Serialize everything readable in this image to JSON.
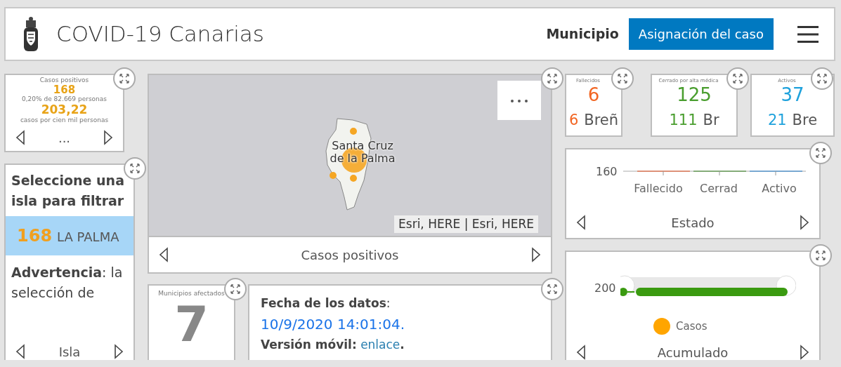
{
  "header": {
    "title": "COVID-19 Canarias",
    "tabs": [
      {
        "label": "Municipio",
        "selected": false
      },
      {
        "label": "Asignación del caso",
        "selected": true
      }
    ]
  },
  "positives_card": {
    "title": "Casos positivos",
    "value": "168",
    "value_note": "0,20% de 82.669 personas",
    "rate": "203,22",
    "rate_note": "casos por cien mil personas",
    "footer": "..."
  },
  "island_list": {
    "title": "Seleccione una isla para filtrar",
    "items": [
      {
        "count": "168",
        "name": "LA PALMA",
        "selected": true
      }
    ],
    "warning": "**Advertencia**: la selección de",
    "footer": "Isla"
  },
  "map": {
    "place_label": "Santa Cruz de la Palma",
    "attribution": "Esri, HERE | Esri, HERE",
    "footer": "Casos positivos"
  },
  "municipios_card": {
    "title": "Municipios afectados",
    "value": "7"
  },
  "info": {
    "date_label": "**Fecha de los datos**:",
    "date_value": "10/9/2020 14:01:04.",
    "mobile_label": "Versión móvil:",
    "mobile_link": "enlace",
    "mobile_suffix": "."
  },
  "kpis": [
    {
      "title": "Fallecidos",
      "value": "6",
      "sub_value": "6",
      "sub_label": "Breñ",
      "color": "#f26522"
    },
    {
      "title": "Cerrado por alta médica",
      "value": "125",
      "sub_value": "111",
      "sub_label": "Br",
      "color": "#4a9e2f"
    },
    {
      "title": "Activos",
      "value": "37",
      "sub_value": "21",
      "sub_label": "Bre",
      "color": "#1fa2dc"
    }
  ],
  "status_chart": {
    "tick": "160",
    "categories": [
      "Fallecido",
      "Cerrad",
      "Activo"
    ],
    "footer": "Estado"
  },
  "cumulative_chart": {
    "tick": "200",
    "legend": [
      {
        "label": "Casos",
        "color": "#ffa500"
      }
    ],
    "footer": "Acumulado"
  }
}
